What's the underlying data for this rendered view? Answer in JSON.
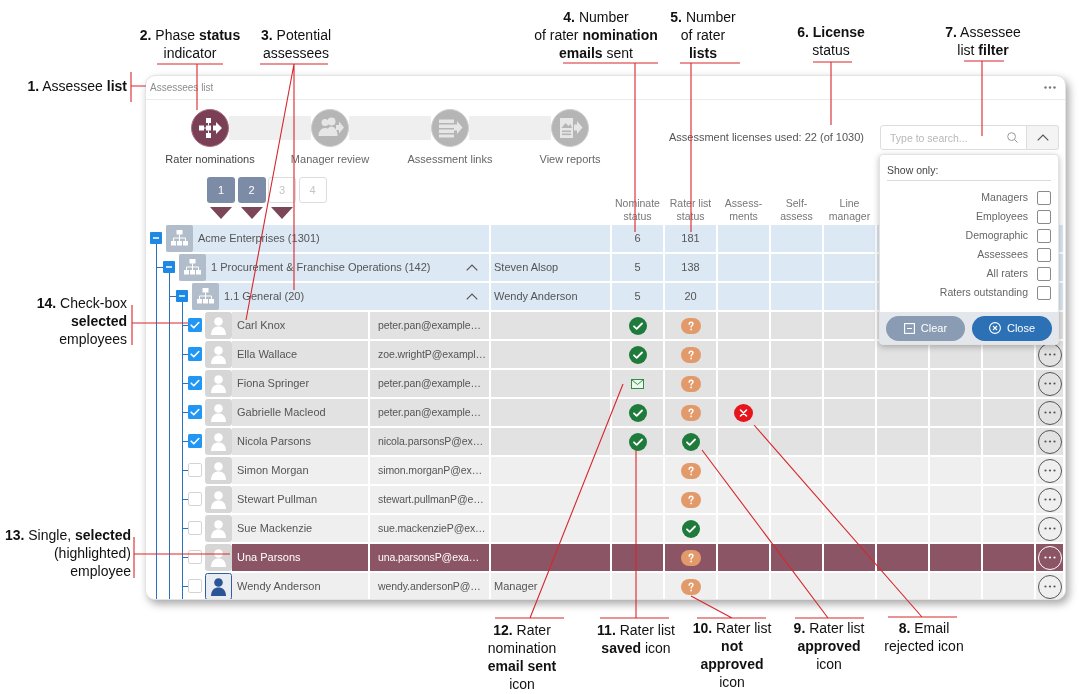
{
  "callouts_top": [
    {
      "text": "**2.** Phase **status**\nindicator"
    },
    {
      "text": "**3.** Potential\nassessees"
    },
    {
      "text": "**4.** Number\nof rater **nomination**\n**emails** sent"
    },
    {
      "text": "**5.** Number\nof rater\n**lists**"
    },
    {
      "text": "**6. License**\nstatus"
    },
    {
      "text": "**7.** Assessee\nlist **filter**"
    }
  ],
  "callouts_left": [
    {
      "text": "**1.** Assessee **list**"
    },
    {
      "text": "**14.** Check-box\n**selected**\nemployees"
    },
    {
      "text": "**13.** Single, **selected**\n(highlighted)\nemployee"
    }
  ],
  "panel": {
    "title": "Assessees list",
    "phases": [
      {
        "label": "Rater nominations",
        "selected": true
      },
      {
        "label": "Manager review",
        "selected": false
      },
      {
        "label": "Assessment links",
        "selected": false
      },
      {
        "label": "View reports",
        "selected": false
      }
    ],
    "license_status": "Assessment licenses used: 22 (of 1030)",
    "search": {
      "placeholder": "Type to search..."
    },
    "filter": {
      "expanded": true,
      "heading": "Show only:",
      "options": [
        {
          "label": "Managers",
          "checked": false
        },
        {
          "label": "Employees",
          "checked": false
        },
        {
          "label": "Demographic",
          "checked": false
        },
        {
          "label": "Assessees",
          "checked": false
        },
        {
          "label": "All raters",
          "checked": false
        },
        {
          "label": "Raters outstanding",
          "checked": false
        }
      ],
      "buttons": [
        {
          "label": "Clear",
          "kind": "clear"
        },
        {
          "label": "Close",
          "kind": "close"
        }
      ]
    },
    "steps": [
      {
        "label": "1",
        "completed": true,
        "marker": true
      },
      {
        "label": "2",
        "completed": true,
        "marker": true
      },
      {
        "label": "3",
        "completed": false,
        "marker": true
      },
      {
        "label": "4",
        "completed": false,
        "marker": false
      }
    ],
    "columns": [
      "Nominate status",
      "Rater list status",
      "Assess-ments",
      "Self-assess",
      "Line manager"
    ],
    "tree": [
      {
        "kind": "group",
        "name": "Acme Enterprises (1301)",
        "expanded": true,
        "chevron_button": false,
        "nominate_count": "6",
        "rater_list_count": "181",
        "children": [
          {
            "kind": "group",
            "name": "1 Procurement & Franchise Operations (142)",
            "expanded": true,
            "chevron_button": true,
            "manager": "Steven Alsop",
            "nominate_count": "5",
            "rater_list_count": "138",
            "children": [
              {
                "kind": "group",
                "name": "1.1 General (20)",
                "expanded": true,
                "chevron_button": true,
                "manager": "Wendy Anderson",
                "nominate_count": "5",
                "rater_list_count": "20",
                "children": [
                  {
                    "kind": "employee",
                    "name": "Carl Knox",
                    "email": "peter.pan@example…",
                    "checked": true,
                    "selected": false,
                    "avatar": {
                      "kind": "plain"
                    },
                    "nominate_status": {
                      "kind": "saved"
                    },
                    "rater_list_status": {
                      "kind": "not_approved"
                    },
                    "more_button": false
                  },
                  {
                    "kind": "employee",
                    "name": "Ella Wallace",
                    "email": "zoe.wrightP@exampl…",
                    "checked": true,
                    "selected": false,
                    "avatar": {
                      "kind": "plain"
                    },
                    "nominate_status": {
                      "kind": "saved"
                    },
                    "rater_list_status": {
                      "kind": "not_approved"
                    },
                    "more_button": true
                  },
                  {
                    "kind": "employee",
                    "name": "Fiona Springer",
                    "email": "peter.pan@example…",
                    "checked": true,
                    "selected": false,
                    "avatar": {
                      "kind": "plain"
                    },
                    "nominate_status": {
                      "kind": "email_sent"
                    },
                    "rater_list_status": {
                      "kind": "not_approved"
                    },
                    "more_button": true
                  },
                  {
                    "kind": "employee",
                    "name": "Gabrielle Macleod",
                    "email": "peter.pan@example…",
                    "checked": true,
                    "selected": false,
                    "avatar": {
                      "kind": "plain"
                    },
                    "nominate_status": {
                      "kind": "saved"
                    },
                    "rater_list_status": {
                      "kind": "not_approved"
                    },
                    "assessments_status": {
                      "kind": "email_rejected"
                    },
                    "more_button": true
                  },
                  {
                    "kind": "employee",
                    "name": "Nicola Parsons",
                    "email": "nicola.parsonsP@ex…",
                    "checked": true,
                    "selected": false,
                    "avatar": {
                      "kind": "plain"
                    },
                    "nominate_status": {
                      "kind": "saved"
                    },
                    "rater_list_status": {
                      "kind": "approved"
                    },
                    "more_button": true
                  },
                  {
                    "kind": "employee",
                    "name": "Simon Morgan",
                    "email": "simon.morganP@ex…",
                    "checked": false,
                    "selected": false,
                    "avatar": {
                      "kind": "plain"
                    },
                    "rater_list_status": {
                      "kind": "not_approved"
                    },
                    "more_button": true
                  },
                  {
                    "kind": "employee",
                    "name": "Stewart Pullman",
                    "email": "stewart.pullmanP@e…",
                    "checked": false,
                    "selected": false,
                    "avatar": {
                      "kind": "plain"
                    },
                    "rater_list_status": {
                      "kind": "not_approved"
                    },
                    "more_button": true
                  },
                  {
                    "kind": "employee",
                    "name": "Sue Mackenzie",
                    "email": "sue.mackenzieP@ex…",
                    "checked": false,
                    "selected": false,
                    "avatar": {
                      "kind": "plain"
                    },
                    "rater_list_status": {
                      "kind": "approved"
                    },
                    "more_button": true
                  },
                  {
                    "kind": "employee",
                    "name": "Una Parsons",
                    "email": "una.parsonsP@exa…",
                    "checked": false,
                    "selected": true,
                    "avatar": {
                      "kind": "plain"
                    },
                    "rater_list_status": {
                      "kind": "not_approved"
                    },
                    "more_button": true
                  },
                  {
                    "kind": "employee",
                    "name": "Wendy Anderson",
                    "email": "wendy.andersonP@…",
                    "role": "Manager",
                    "checked": false,
                    "selected": false,
                    "avatar": {
                      "kind": "outlined"
                    },
                    "rater_list_status": {
                      "kind": "not_approved"
                    },
                    "more_button": true
                  }
                ]
              }
            ]
          }
        ]
      }
    ]
  },
  "callouts_bottom": [
    {
      "text": "**12.** Rater\nnomination\n**email sent**\nicon"
    },
    {
      "text": "**11.** Rater list\n**saved** icon"
    },
    {
      "text": "**10.** Rater list\n**not**\n**approved**\nicon"
    },
    {
      "text": "**9.** Rater list\n**approved**\nicon"
    },
    {
      "text": "**8.** Email\nrejected icon"
    }
  ]
}
